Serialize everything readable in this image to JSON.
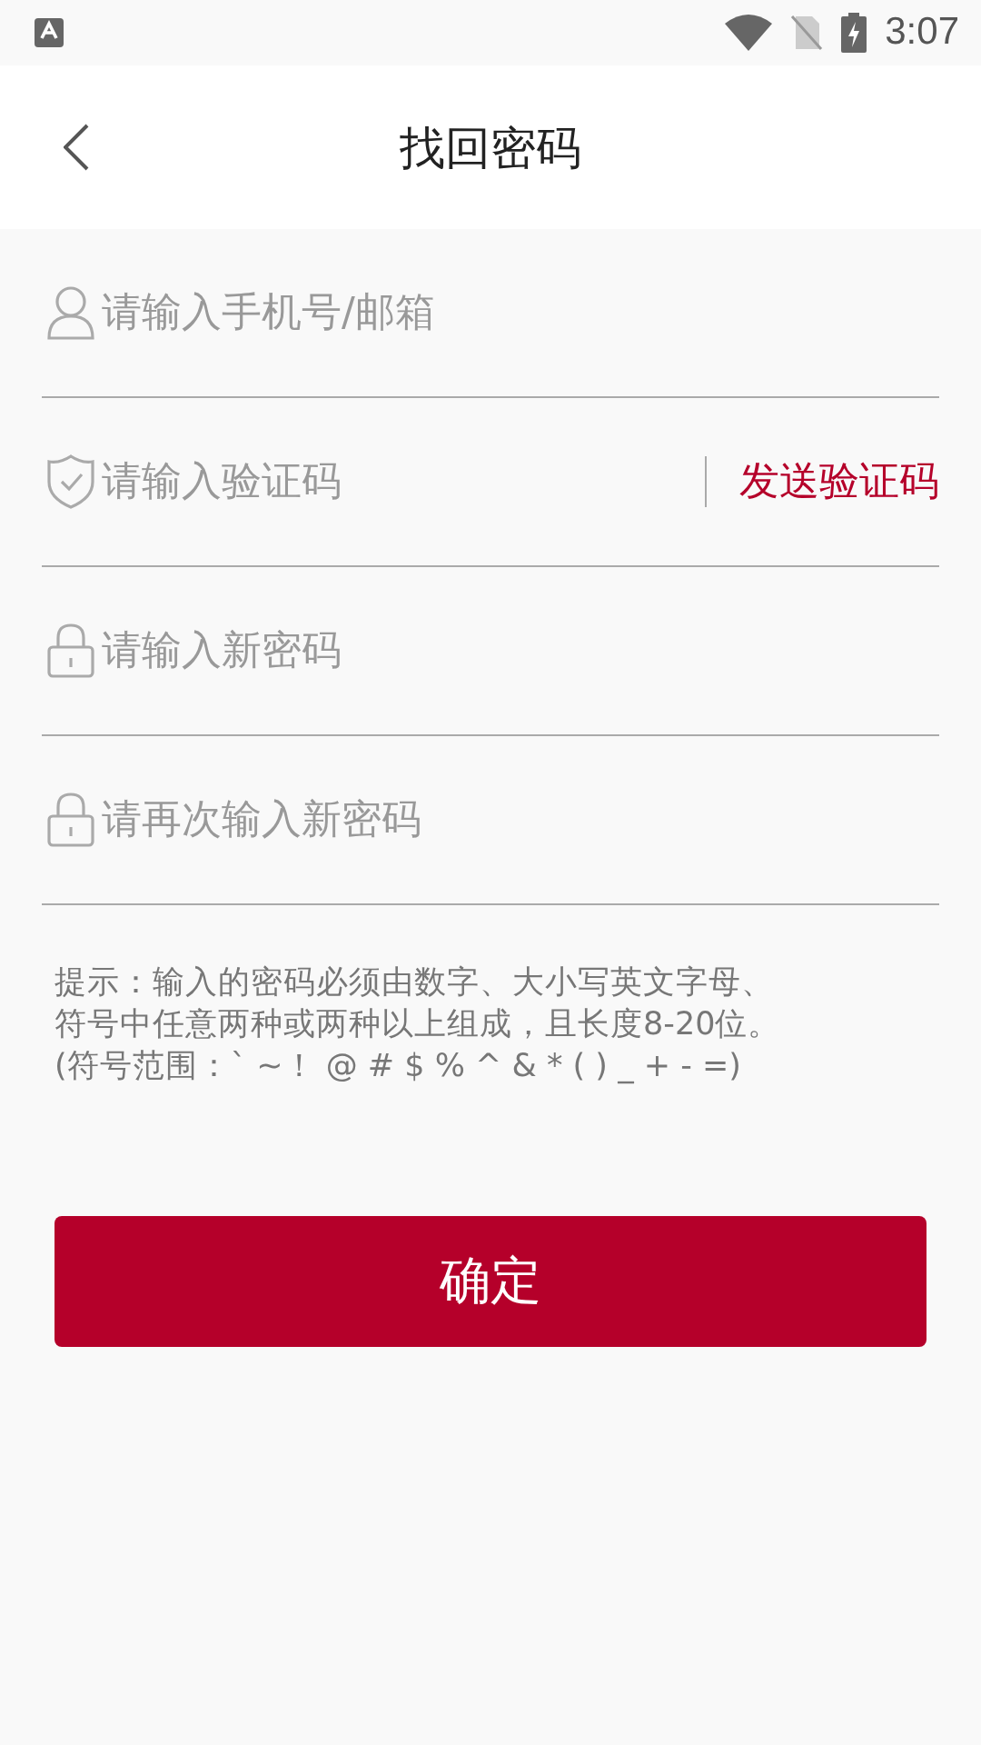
{
  "status_bar": {
    "time": "3:07"
  },
  "header": {
    "title": "找回密码"
  },
  "fields": [
    {
      "kind": "user",
      "placeholder": "请输入手机号/邮箱"
    },
    {
      "kind": "shield",
      "placeholder": "请输入验证码",
      "action": "发送验证码"
    },
    {
      "kind": "lock",
      "placeholder": "请输入新密码"
    },
    {
      "kind": "lock",
      "placeholder": "请再次输入新密码"
    }
  ],
  "hint_lines": [
    "提示：输入的密码必须由数字、大小写英文字母、",
    "符号中任意两种或两种以上组成，且长度8-20位。",
    "(符号范围：` ~！  @ # $ % ^ & * ( ) _ + - =)"
  ],
  "submit": "确定"
}
